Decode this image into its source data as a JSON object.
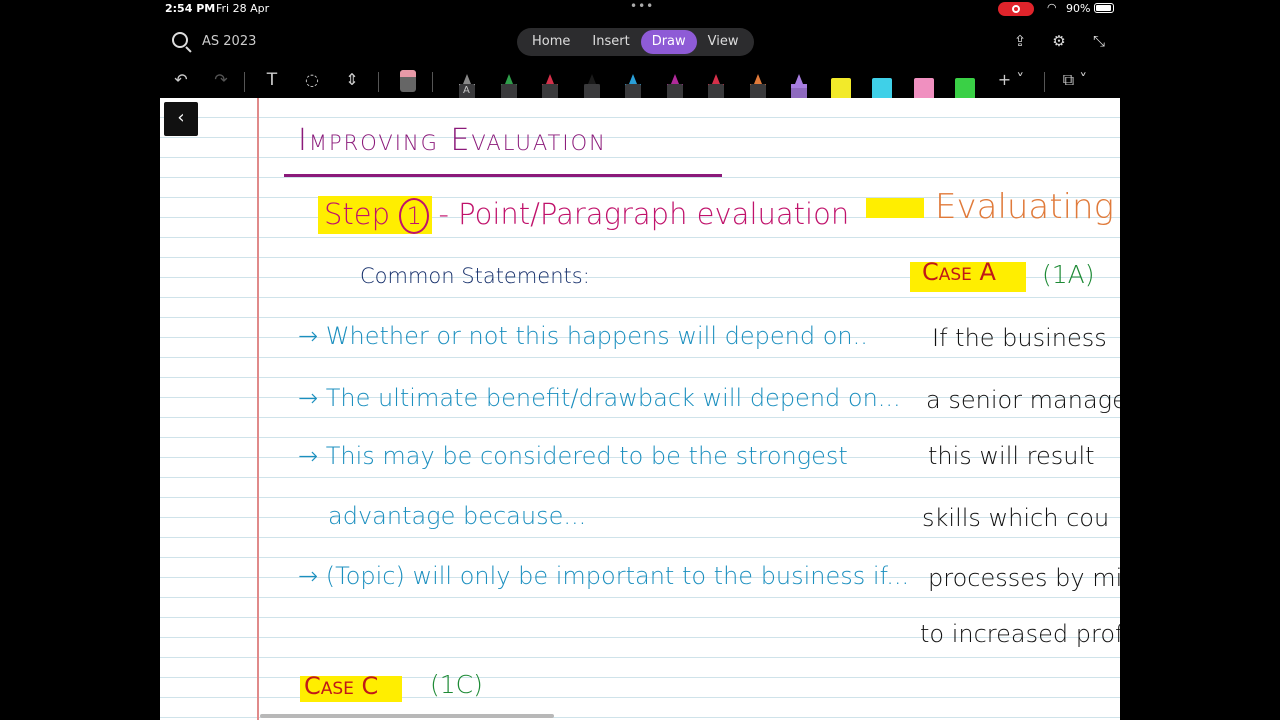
{
  "status_bar": {
    "time": "2:54 PM",
    "date": "Fri 28 Apr",
    "battery": "90%"
  },
  "header": {
    "doc_title": "AS 2023",
    "tabs": [
      "Home",
      "Insert",
      "Draw",
      "View"
    ],
    "active_tab": "Draw"
  },
  "toolbar": {
    "pen_colors": [
      "#c8c8c8",
      "#2e9e4a",
      "#d6304a",
      "#1a1a1a",
      "#2a9fd8",
      "#b02a9a",
      "#d6304a",
      "#e07a3a",
      "#a77de0"
    ],
    "highlighter_colors": [
      "#f2ea2a",
      "#3fd0e8",
      "#f090c0",
      "#3ad046"
    ],
    "pen_label": "A"
  },
  "note": {
    "title": "Improving Evaluation",
    "step_label": "Step",
    "step_number": "1",
    "step_text": " - Point/Paragraph evaluation",
    "right_heading": "Evaluating be",
    "common_statements": "Common Statements:",
    "bullets": [
      "Whether or not this happens will depend on..",
      "The ultimate benefit/drawback will depend on...",
      "This may be considered to be the strongest",
      "advantage because...",
      "(Topic) will only be important to the business if..."
    ],
    "case_a_label": "Case A",
    "case_a_code": "(1A)",
    "case_a_lines": [
      "If the business",
      "a senior manage",
      "this will result",
      "skills which cou",
      "processes by minin",
      "to increased prof"
    ],
    "case_c_label": "Case C",
    "case_c_code": "(1C)"
  }
}
